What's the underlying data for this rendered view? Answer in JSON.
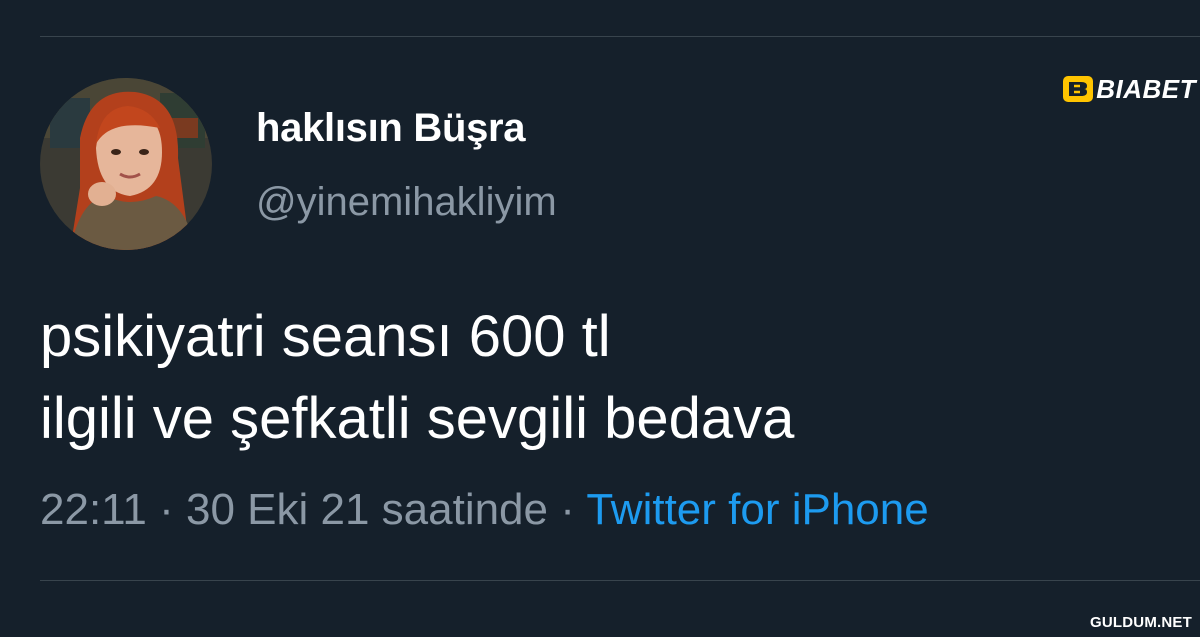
{
  "tweet": {
    "display_name": "haklısın Büşra",
    "handle": "@yinemihakliyim",
    "text_lines": [
      "psikiyatri seansı 600 tl",
      "ilgili ve şefkatli sevgili bedava"
    ],
    "time": "22:11",
    "separator": "·",
    "date": "30 Eki 21 saatinde",
    "source": "Twitter for iPhone"
  },
  "watermarks": {
    "top_right_brand": "BIABET",
    "bottom_right_site": "GULDUM.NET"
  },
  "colors": {
    "background": "#15202b",
    "primary_text": "#ffffff",
    "secondary_text": "#8b98a5",
    "link": "#1d9bf0",
    "divider": "#38444d"
  },
  "icons": {
    "avatar": "profile-photo-woman-red-hair"
  }
}
